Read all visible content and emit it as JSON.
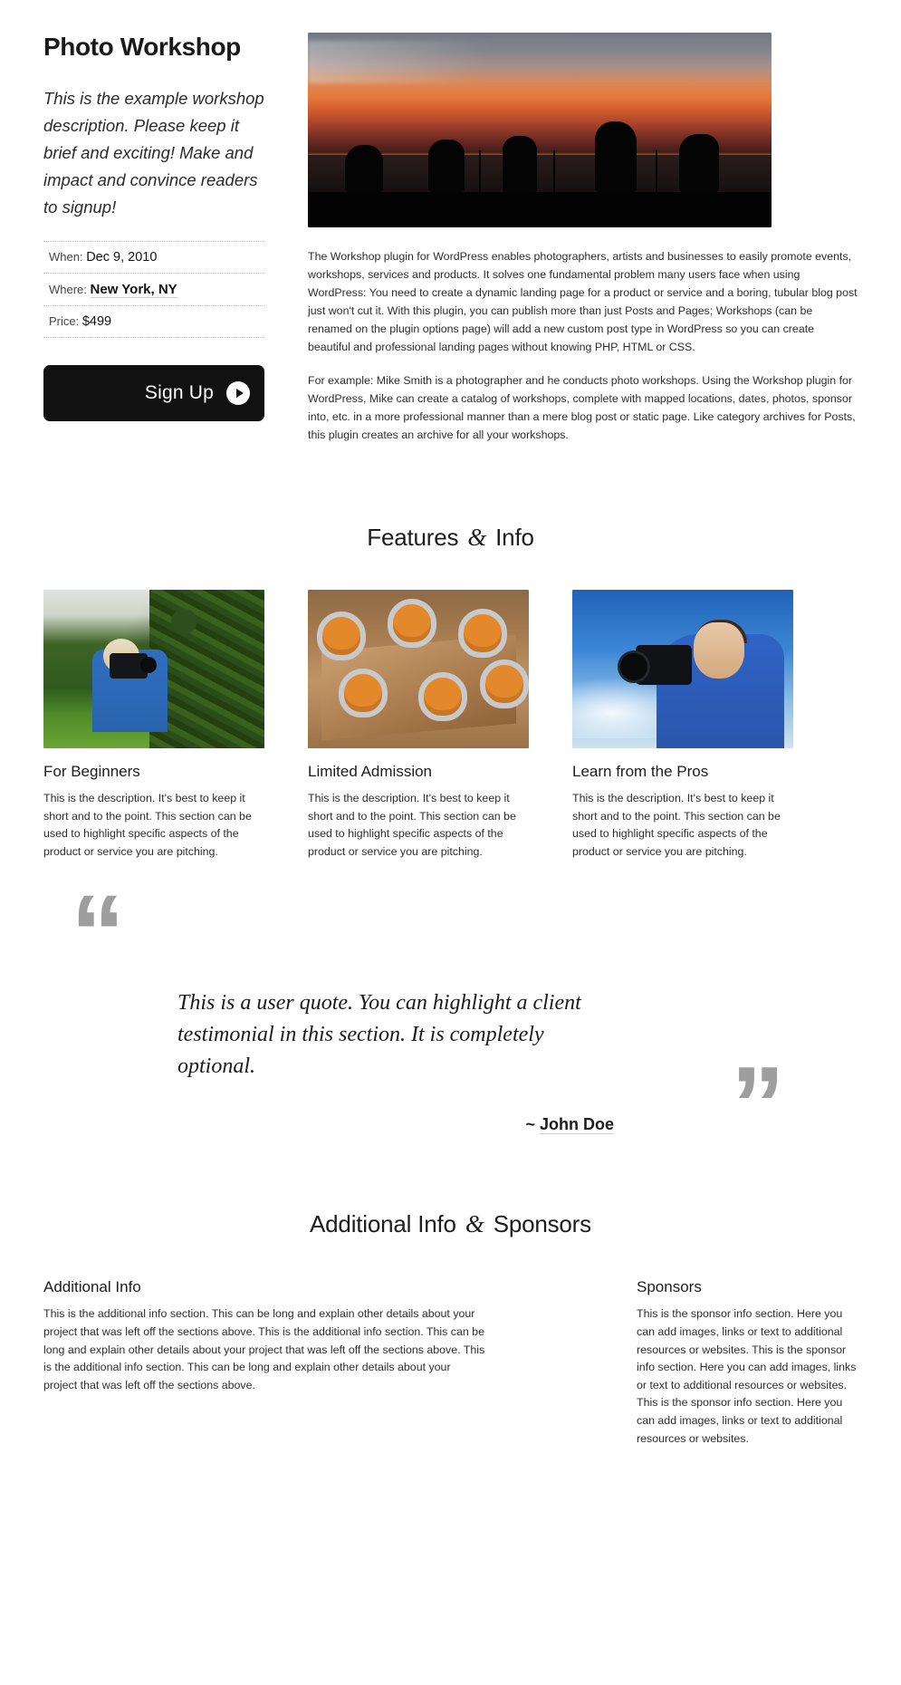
{
  "hero": {
    "title": "Photo Workshop",
    "lede": "This is the example workshop description. Please keep it brief and exciting! Make and impact and convince readers to signup!",
    "meta": [
      {
        "key": "When:",
        "value": "Dec 9, 2010",
        "strong": false
      },
      {
        "key": "Where:",
        "value": "New York, NY",
        "strong": true
      },
      {
        "key": "Price:",
        "value": "$499",
        "strong": false
      }
    ],
    "signup_label": "Sign Up",
    "photo_alt": "photographers-silhouette-sunset-photo",
    "body_paragraph_1": "The Workshop plugin for WordPress enables photographers, artists and businesses to easily promote events, workshops, services and products.  It solves one fundamental problem many users face when using WordPress:  You need to create a dynamic landing page for a product or service and a boring, tubular blog post just won't cut it.  With this plugin, you can publish more than just Posts and Pages; Workshops (can be renamed on the plugin options page) will add a new custom post type in WordPress so you can create beautiful and professional landing pages without knowing PHP, HTML or CSS.",
    "body_paragraph_2": "For example:  Mike Smith is a photographer and he conducts photo workshops.  Using the Workshop plugin for WordPress, Mike can create a catalog of workshops, complete with mapped locations, dates, photos, sponsor into, etc. in a more professional manner than a mere blog post or static page.  Like category archives for Posts, this plugin creates an archive for all your workshops."
  },
  "features_section": {
    "heading_before": "Features",
    "heading_amp": "&",
    "heading_after": "Info",
    "cards": [
      {
        "title": "For Beginners",
        "photo_alt": "girl-with-camera-in-hedge-photo",
        "description": "This is the description. It's best to keep it short and to the point. This section can be used to highlight specific aspects of the product or service you are pitching."
      },
      {
        "title": "Limited Admission",
        "photo_alt": "orange-chairs-around-wooden-table-photo",
        "description": "This is the description. It's best to keep it short and to the point. This section can be used to highlight specific aspects of the product or service you are pitching."
      },
      {
        "title": "Learn from the Pros",
        "photo_alt": "man-shooting-camera-against-blue-sky-photo",
        "description": "This is the description. It's best to keep it short and to the point. This section can be used to highlight specific aspects of the product or service you are pitching."
      }
    ]
  },
  "quote_section": {
    "open_quote": "“",
    "close_quote": "”",
    "text": "This is a user quote. You can highlight a client testimonial in this section. It is completely optional.",
    "cite_prefix": "~ ",
    "cite_name": "John Doe"
  },
  "additional_section": {
    "heading_before": "Additional Info",
    "heading_amp": "&",
    "heading_after": "Sponsors",
    "additional_info": {
      "title": "Additional Info",
      "body": "This is the additional info section. This can be long and explain other details about your project that was left off the sections above. This is the additional info section. This can be long and explain other details about your project that was left off the sections above. This is the additional info section. This can be long and explain other details about your project that was left off the sections above."
    },
    "sponsors": {
      "title": "Sponsors",
      "body": "This is the sponsor info section. Here you can add images, links or text to additional resources or websites. This is the sponsor info section. Here you can add images, links or text to additional resources or websites. This is the sponsor info section. Here you can add images, links or text to additional resources or websites."
    }
  },
  "colors": {
    "button_bg": "#111111",
    "button_text": "#ffffff",
    "quote_mark": "#9e9e9e",
    "text": "#2d2d2d",
    "rule": "#bdbdbd"
  }
}
